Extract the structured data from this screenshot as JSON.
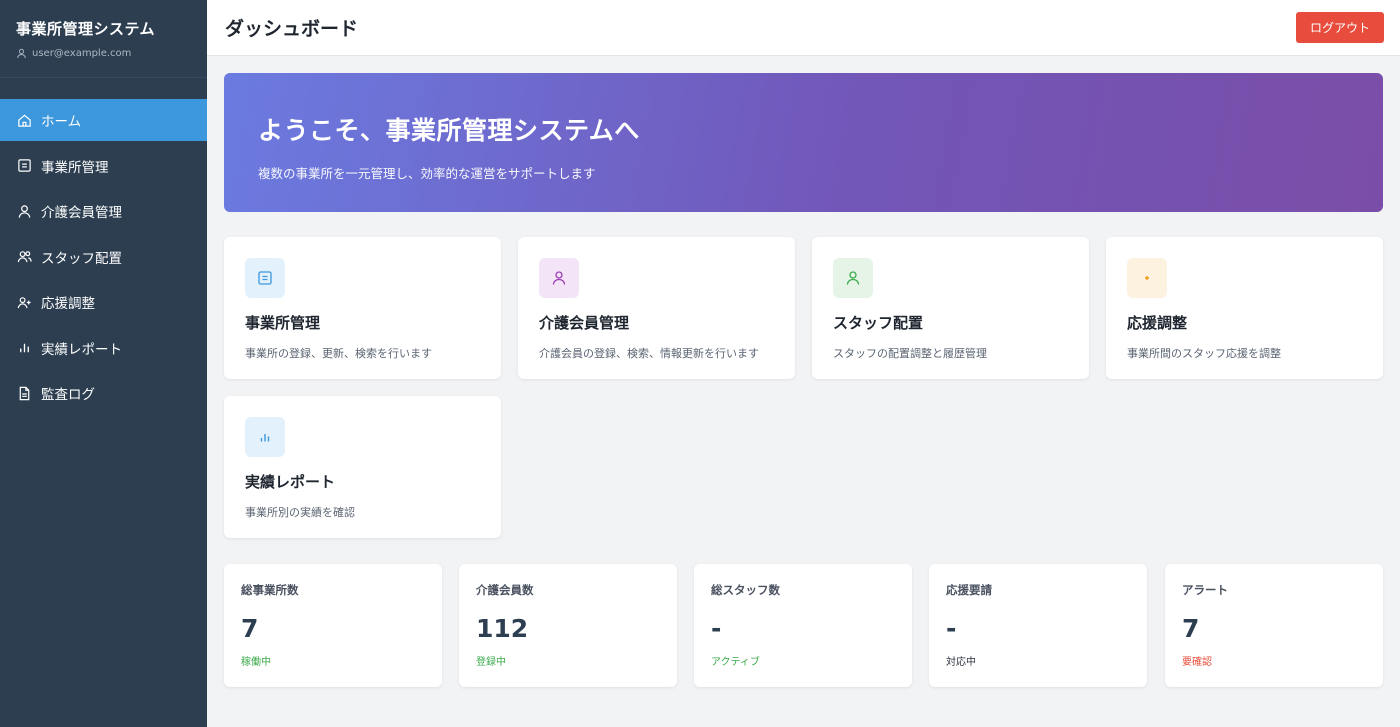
{
  "sidebar": {
    "title": "事業所管理システム",
    "user_email": "user@example.com",
    "items": [
      {
        "label": "ホーム",
        "icon": "home-icon"
      },
      {
        "label": "事業所管理",
        "icon": "office-icon"
      },
      {
        "label": "介護会員管理",
        "icon": "person-icon"
      },
      {
        "label": "スタッフ配置",
        "icon": "people-icon"
      },
      {
        "label": "応援調整",
        "icon": "person-add-icon"
      },
      {
        "label": "実績レポート",
        "icon": "bar-chart-icon"
      },
      {
        "label": "監査ログ",
        "icon": "document-icon"
      }
    ]
  },
  "header": {
    "title": "ダッシュボード",
    "logout_label": "ログアウト"
  },
  "banner": {
    "title": "ようこそ、事業所管理システムへ",
    "subtitle": "複数の事業所を一元管理し、効率的な運営をサポートします"
  },
  "features": [
    {
      "title": "事業所管理",
      "desc": "事業所の登録、更新、検索を行います",
      "icon": "office-icon",
      "color": "#3c97dc",
      "bg": "#e3f1fc"
    },
    {
      "title": "介護会員管理",
      "desc": "介護会員の登録、検索、情報更新を行います",
      "icon": "person-icon",
      "color": "#9b3db8",
      "bg": "#f3e5f7"
    },
    {
      "title": "スタッフ配置",
      "desc": "スタッフの配置調整と履歴管理",
      "icon": "person-icon",
      "color": "#3aaa4a",
      "bg": "#e6f4e7"
    },
    {
      "title": "応援調整",
      "desc": "事業所間のスタッフ応援を調整",
      "icon": "sparkle-icon",
      "color": "#f39c12",
      "bg": "#fdf1e0"
    },
    {
      "title": "実績レポート",
      "desc": "事業所別の実績を確認",
      "icon": "bar-chart-icon",
      "color": "#3c97dc",
      "bg": "#e3f1fc"
    }
  ],
  "stats": [
    {
      "label": "総事業所数",
      "value": "7",
      "note": "稼働中",
      "note_color": "#3aaa4a"
    },
    {
      "label": "介護会員数",
      "value": "112",
      "note": "登録中",
      "note_color": "#3aaa4a"
    },
    {
      "label": "総スタッフ数",
      "value": "-",
      "note": "アクティブ",
      "note_color": "#3aaa4a"
    },
    {
      "label": "応援要請",
      "value": "-",
      "note": "対応中",
      "note_color": "#2c3440"
    },
    {
      "label": "アラート",
      "value": "7",
      "note": "要確認",
      "note_color": "#e74c3c"
    }
  ]
}
